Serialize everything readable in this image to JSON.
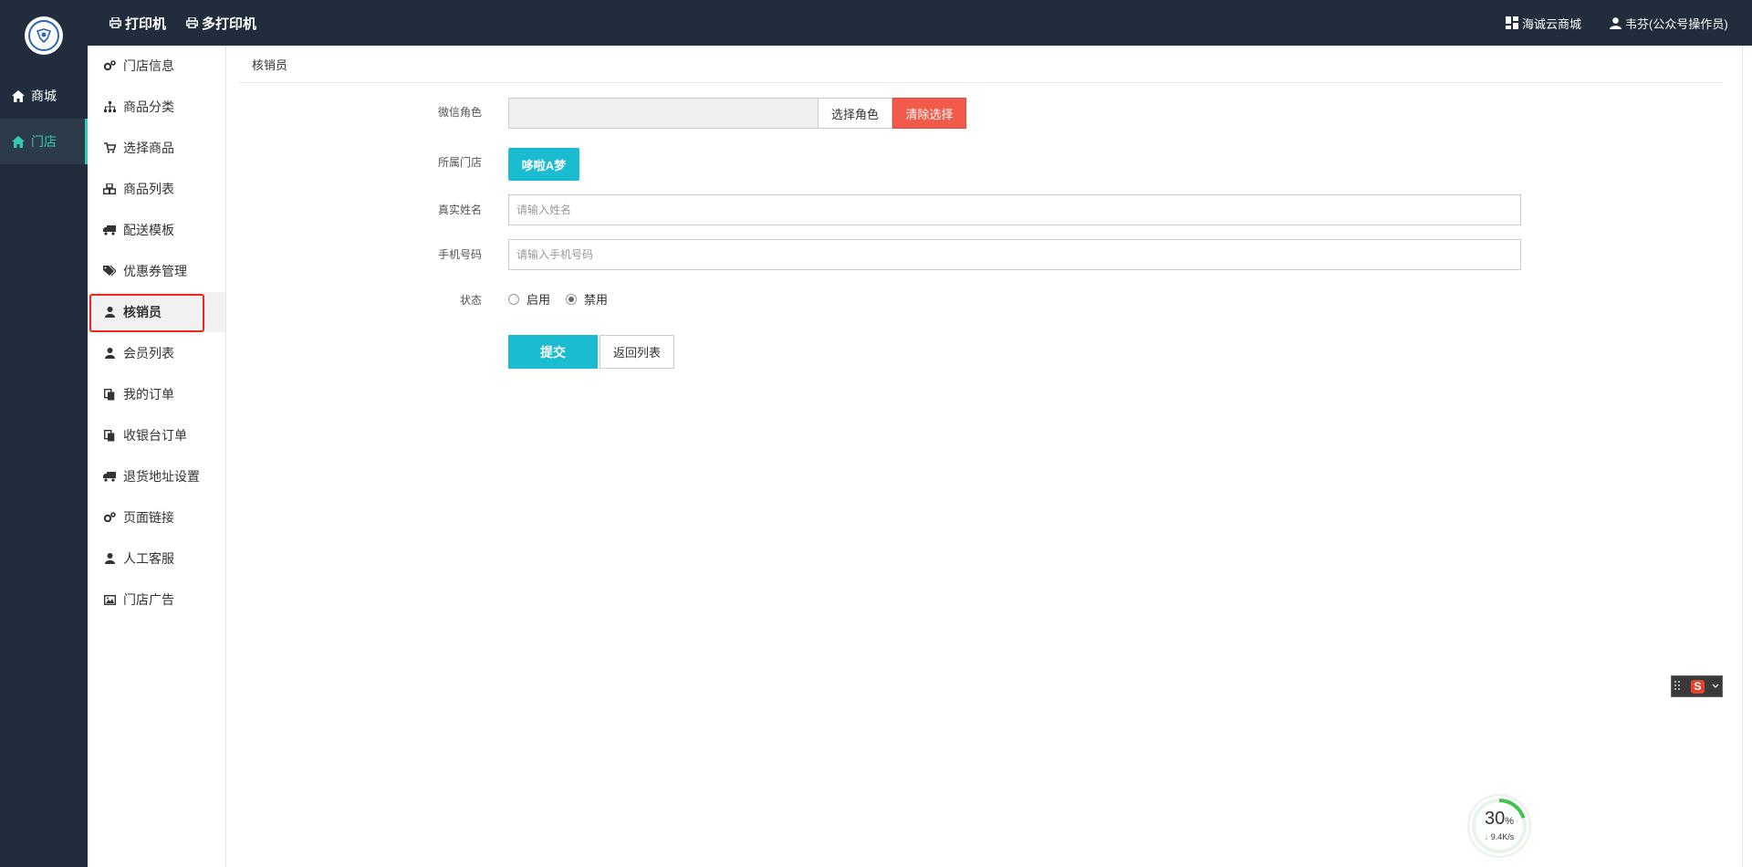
{
  "rail": {
    "items": [
      {
        "label": "商城",
        "icon": "home-icon"
      },
      {
        "label": "门店",
        "icon": "home-icon"
      }
    ]
  },
  "topbar": {
    "print_label": "打印机",
    "multi_print_label": "多打印机",
    "mall_label": "海诚云商城",
    "user_label": "韦芬(公众号操作员)"
  },
  "sidebar": {
    "items": [
      {
        "label": "门店信息",
        "icon": "cogs-icon"
      },
      {
        "label": "商品分类",
        "icon": "sitemap-icon"
      },
      {
        "label": "选择商品",
        "icon": "cart-icon"
      },
      {
        "label": "商品列表",
        "icon": "cubes-icon"
      },
      {
        "label": "配送模板",
        "icon": "truck-icon"
      },
      {
        "label": "优惠券管理",
        "icon": "tags-icon"
      },
      {
        "label": "核销员",
        "icon": "user-icon"
      },
      {
        "label": "会员列表",
        "icon": "user-icon"
      },
      {
        "label": "我的订单",
        "icon": "copy-icon"
      },
      {
        "label": "收银台订单",
        "icon": "copy-icon"
      },
      {
        "label": "退货地址设置",
        "icon": "truck-icon"
      },
      {
        "label": "页面链接",
        "icon": "cogs-icon"
      },
      {
        "label": "人工客服",
        "icon": "user-icon"
      },
      {
        "label": "门店广告",
        "icon": "image-icon"
      }
    ]
  },
  "breadcrumb": "核销员",
  "form": {
    "role_label": "微信角色",
    "role_value": "",
    "select_role_label": "选择角色",
    "clear_label": "清除选择",
    "store_label": "所属门店",
    "store_value": "哆啦A梦",
    "name_label": "真实姓名",
    "name_placeholder": "请输入姓名",
    "phone_label": "手机号码",
    "phone_placeholder": "请输入手机号码",
    "status_label": "状态",
    "status_options": [
      "启用",
      "禁用"
    ],
    "status_selected": "禁用",
    "submit_label": "提交",
    "back_label": "返回列表"
  },
  "widgets": {
    "speed_value": "30",
    "speed_unit": "%",
    "speed_rate": "9.4K/s"
  },
  "colors": {
    "dark": "#212c3c",
    "accent": "#33c9b4",
    "primary": "#1bbcd1",
    "danger": "#f25a4a"
  }
}
